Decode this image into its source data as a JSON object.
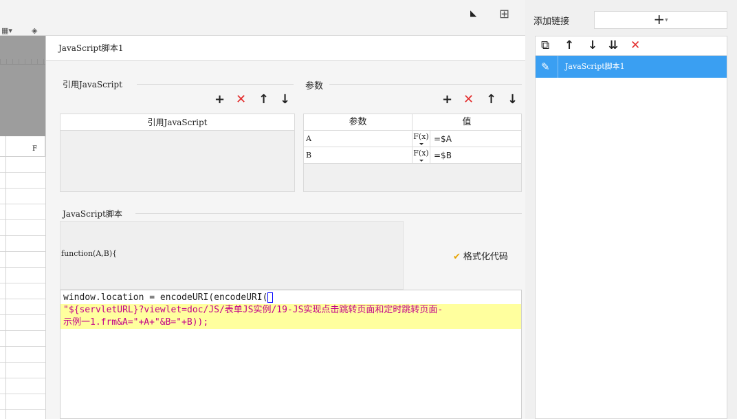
{
  "dialog": {
    "title": "JavaScript脚本1",
    "ref_js": {
      "group_title": "引用JavaScript",
      "column_header": "引用JavaScript"
    },
    "params": {
      "group_title": "参数",
      "columns": [
        "参数",
        "值"
      ],
      "rows": [
        {
          "name": "A",
          "formula_label": "F(x)",
          "value": "=$A"
        },
        {
          "name": "B",
          "formula_label": "F(x)",
          "value": "=$B"
        }
      ]
    },
    "script": {
      "group_title": "JavaScript脚本",
      "signature": "function(A,B){",
      "format_button_label": "格式化代码",
      "code_lines": [
        "window.location = encodeURI(encodeURI(",
        "\"${servletURL}?viewlet=doc/JS/表单JS实例/19-JS实现点击跳转页面和定时跳转页面-",
        "示例一1.frm&A=\"+A+\"&B=\"+B));"
      ]
    },
    "toolbar_glyphs": {
      "add": "+",
      "delete": "✕",
      "up": "↑",
      "down": "↓"
    }
  },
  "right_panel": {
    "add_link_label": "添加链接",
    "add_button_glyph": "+",
    "caret": "▾",
    "tool_glyphs": {
      "copy": "⧉",
      "up": "↑",
      "down": "↓",
      "sort": "⇊",
      "delete": "✕"
    },
    "items": [
      {
        "label": "JavaScript脚本1",
        "selected": true
      }
    ]
  },
  "sheet": {
    "column_label": "F"
  },
  "colors": {
    "selection": "#3a9ff2",
    "delete_red": "#e32c2c",
    "string_magenta": "#c2008a",
    "highlight_line": "#ffff9e"
  }
}
